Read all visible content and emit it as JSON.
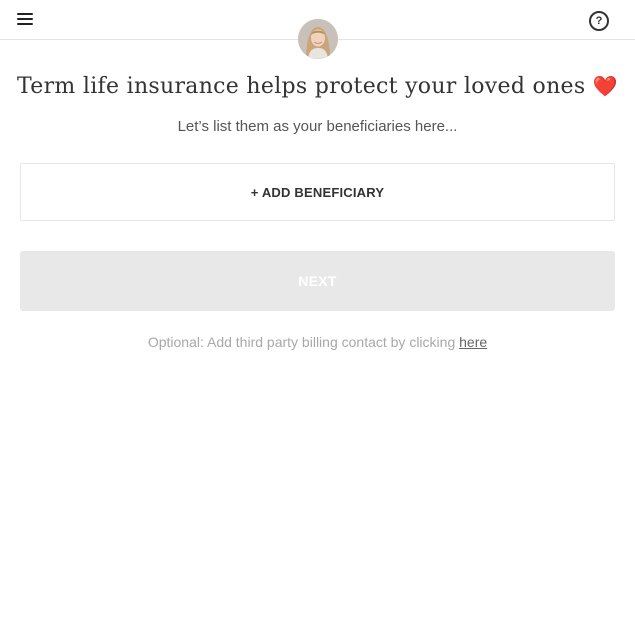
{
  "header": {
    "menu_icon": "hamburger-menu-icon",
    "avatar": "advisor-avatar",
    "help_icon_glyph": "?"
  },
  "main": {
    "title": "Term life insurance helps protect your loved ones",
    "title_emoji": "❤️",
    "subtitle": "Let’s list them as your beneficiaries here...",
    "add_beneficiary_label": "+ ADD BENEFICIARY",
    "next_label": "NEXT",
    "optional_text": "Optional: Add third party billing contact by clicking ",
    "optional_link": "here"
  },
  "colors": {
    "next_disabled_bg": "#e8e8e8",
    "border": "#e3e3e3"
  }
}
